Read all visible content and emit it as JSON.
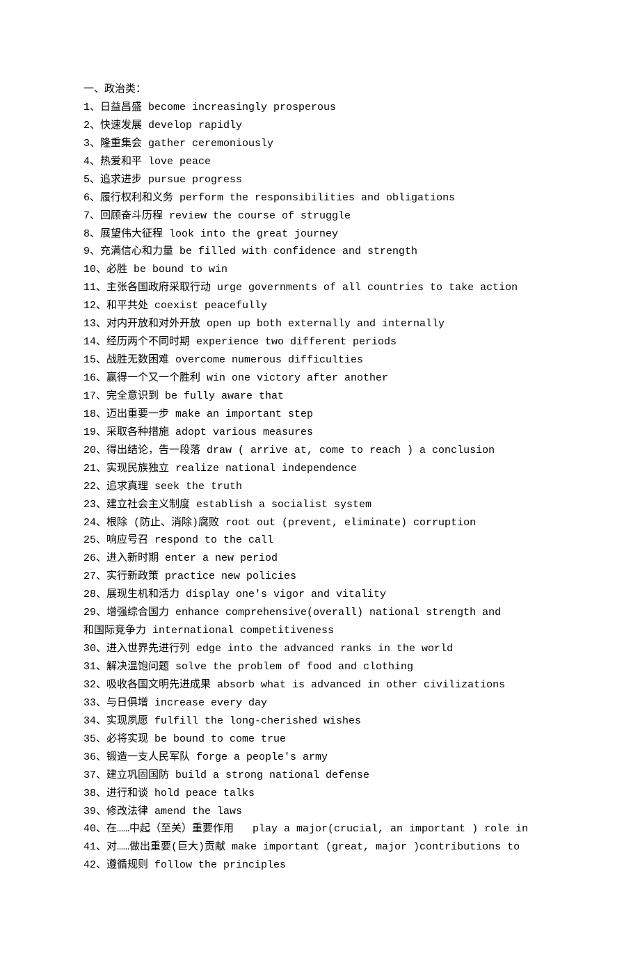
{
  "heading": "一、政治类：",
  "items": [
    "1、日益昌盛 become increasingly prosperous",
    "2、快速发展 develop rapidly",
    "3、隆重集会 gather ceremoniously",
    "4、热爱和平 love peace",
    "5、追求进步 pursue progress",
    "6、履行权利和义务 perform the responsibilities and obligations",
    "7、回顾奋斗历程 review the course of struggle",
    "8、展望伟大征程 look into the great journey",
    "9、充满信心和力量 be filled with confidence and strength",
    "10、必胜 be bound to win",
    "11、主张各国政府采取行动 urge governments of all countries to take action",
    "12、和平共处 coexist peacefully",
    "13、对内开放和对外开放 open up both externally and internally",
    "14、经历两个不同时期 experience two different periods",
    "15、战胜无数困难 overcome numerous difficulties",
    "16、赢得一个又一个胜利 win one victory after another",
    "17、完全意识到 be fully aware that",
    "18、迈出重要一步 make an important step",
    "19、采取各种措施 adopt various measures",
    "20、得出结论，告一段落 draw ( arrive at, come to reach ) a conclusion",
    "21、实现民族独立 realize national independence",
    "22、追求真理 seek the truth",
    "23、建立社会主义制度 establish a socialist system",
    "24、根除 (防止、消除)腐败 root out (prevent, eliminate) corruption",
    "25、响应号召 respond to the call",
    "26、进入新时期 enter a new period",
    "27、实行新政策 practice new policies",
    "28、展现生机和活力 display one's vigor and vitality",
    "29、增强综合国力 enhance comprehensive(overall) national strength and",
    "和国际竞争力 international competitiveness",
    "30、进入世界先进行列 edge into the advanced ranks in the world",
    "31、解决温饱问题 solve the problem of food and clothing",
    "32、吸收各国文明先进成果 absorb what is advanced in other civilizations",
    "33、与日俱增 increase every day",
    "34、实现夙愿 fulfill the long-cherished wishes",
    "35、必将实现 be bound to come true",
    "36、锻造一支人民军队 forge a people's army",
    "37、建立巩固国防 build a strong national defense",
    "38、进行和谈 hold peace talks",
    "39、修改法律 amend the laws",
    "40、在……中起（至关）重要作用   play a major(crucial, an important ) role in",
    "41、对……做出重要(巨大)贡献 make important (great, major )contributions to",
    "42、遵循规则 follow the principles"
  ]
}
